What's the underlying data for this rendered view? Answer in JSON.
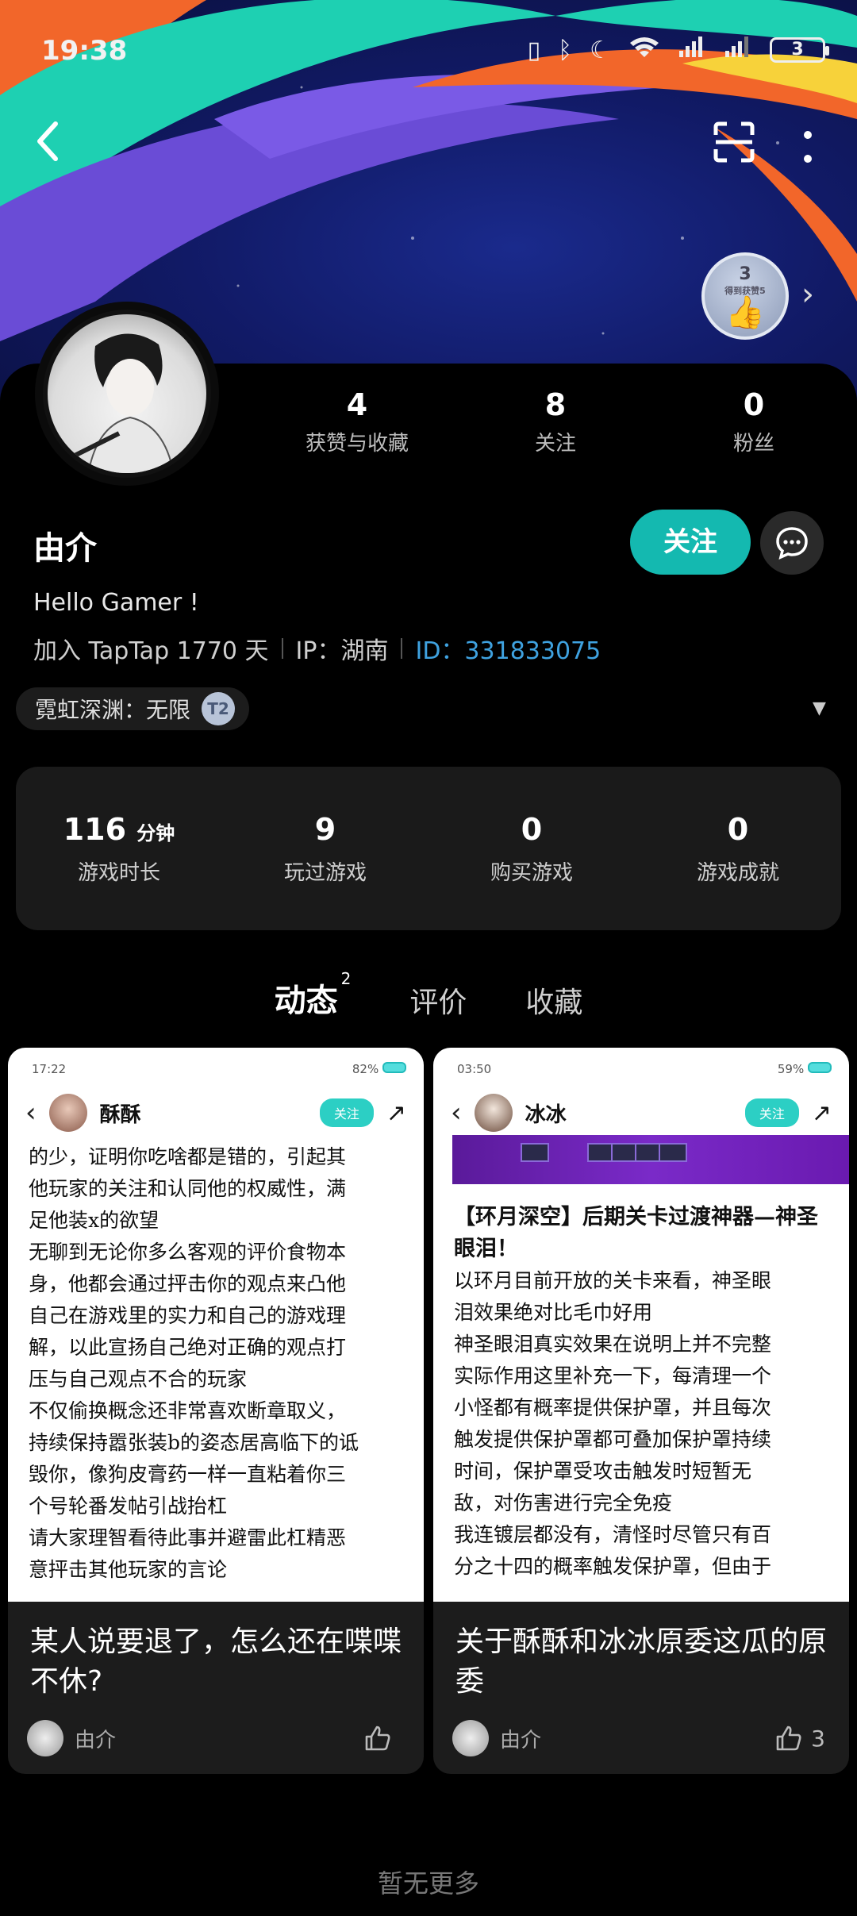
{
  "status_bar": {
    "time": "19:38",
    "battery": "3"
  },
  "profile": {
    "name": "由介",
    "bio": "Hello Gamer !",
    "joined": "加入 TapTap 1770 天",
    "ip": "IP：湖南",
    "id": "ID：331833075",
    "badge_level": "3",
    "badge_text": "得到获赞5"
  },
  "stats": [
    {
      "value": "4",
      "label": "获赞与收藏"
    },
    {
      "value": "8",
      "label": "关注"
    },
    {
      "value": "0",
      "label": "粉丝"
    }
  ],
  "actions": {
    "follow_label": "关注"
  },
  "tag": {
    "text": "霓虹深渊：无限",
    "icon_text": "T2"
  },
  "game_stats": [
    {
      "value": "116",
      "unit": "分钟",
      "label": "游戏时长"
    },
    {
      "value": "9",
      "unit": "",
      "label": "玩过游戏"
    },
    {
      "value": "0",
      "unit": "",
      "label": "购买游戏"
    },
    {
      "value": "0",
      "unit": "",
      "label": "游戏成就"
    }
  ],
  "tabs": [
    {
      "label": "动态",
      "count": "2",
      "active": true
    },
    {
      "label": "评价",
      "count": "",
      "active": false
    },
    {
      "label": "收藏",
      "count": "",
      "active": false
    }
  ],
  "posts": [
    {
      "shot_time": "17:22",
      "shot_batt": "82%",
      "shot_user": "酥酥",
      "shot_follow": "关注",
      "shot_lines": [
        "的少，证明你吃啥都是错的，引起其",
        "他玩家的关注和认同他的权威性，满",
        "足他装x的欲望",
        "无聊到无论你多么客观的评价食物本",
        "身，他都会通过抨击你的观点来凸他",
        "自己在游戏里的实力和自己的游戏理",
        "解，以此宣扬自己绝对正确的观点打",
        "压与自己观点不合的玩家",
        "不仅偷换概念还非常喜欢断章取义，",
        "持续保持嚣张装b的姿态居高临下的诋",
        "毁你，像狗皮膏药一样一直粘着你三",
        "个号轮番发帖引战抬杠",
        "请大家理智看待此事并避雷此杠精恶",
        "意抨击其他玩家的言论"
      ],
      "title": "某人说要退了，怎么还在喋喋不休?",
      "author": "由介",
      "likes": ""
    },
    {
      "shot_time": "03:50",
      "shot_batt": "59%",
      "shot_user": "冰冰",
      "shot_follow": "关注",
      "shot_heading": "【环月深空】后期关卡过渡神器—神圣眼泪！",
      "shot_lines": [
        "以环月目前开放的关卡来看，神圣眼",
        "泪效果绝对比毛巾好用",
        "神圣眼泪真实效果在说明上并不完整",
        "实际作用这里补充一下，每清理一个",
        "小怪都有概率提供保护罩，并且每次",
        "触发提供保护罩都可叠加保护罩持续",
        "时间，保护罩受攻击触发时短暂无",
        "敌，对伤害进行完全免疫",
        "我连镀层都没有，清怪时尽管只有百",
        "分之十四的概率触发保护罩，但由于"
      ],
      "title": "关于酥酥和冰冰原委这瓜的原委",
      "author": "由介",
      "likes": "3"
    }
  ],
  "footer": {
    "no_more": "暂无更多"
  },
  "colors": {
    "accent": "#14b9b0",
    "id_link": "#3fa2e0"
  }
}
